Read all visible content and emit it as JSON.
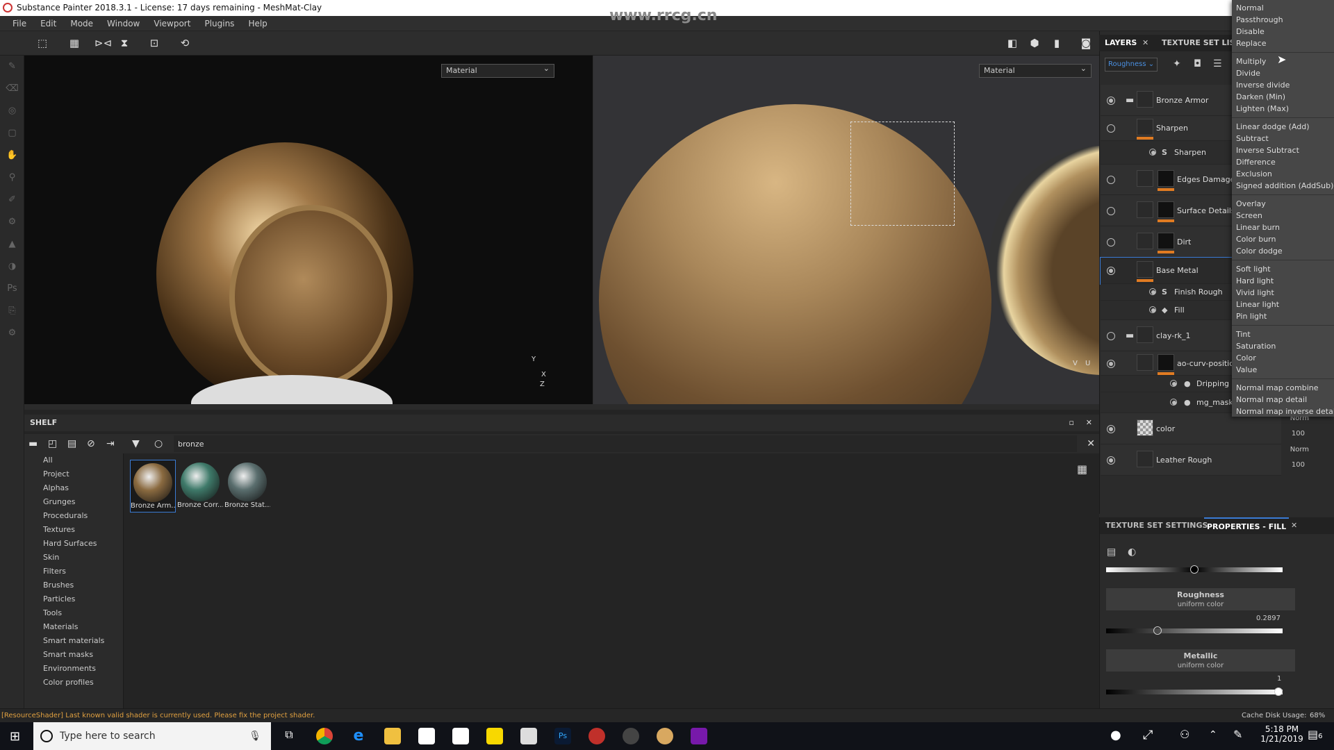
{
  "title": "Substance Painter 2018.3.1 - License: 17 days remaining - MeshMat-Clay",
  "menu": [
    "File",
    "Edit",
    "Mode",
    "Window",
    "Viewport",
    "Plugins",
    "Help"
  ],
  "viewport3d": {
    "mode": "Material",
    "axes": [
      "Y",
      "X",
      "Z"
    ]
  },
  "viewport2d": {
    "mode": "Material",
    "axes": [
      "V",
      "U"
    ]
  },
  "watermark": "www.rrcg.cn",
  "shelf": {
    "title": "SHELF",
    "search": "bronze",
    "categories": [
      "All",
      "Project",
      "Alphas",
      "Grunges",
      "Procedurals",
      "Textures",
      "Hard Surfaces",
      "Skin",
      "Filters",
      "Brushes",
      "Particles",
      "Tools",
      "Materials",
      "Smart materials",
      "Smart masks",
      "Environments",
      "Color profiles"
    ],
    "items": [
      {
        "label": "Bronze Arm...",
        "color": "#8a6a40"
      },
      {
        "label": "Bronze Corr...",
        "color": "#3f7a6a"
      },
      {
        "label": "Bronze Stat...",
        "color": "#5a6e6e"
      }
    ]
  },
  "layers": {
    "tabs": [
      "LAYERS",
      "TEXTURE SET LIST"
    ],
    "channel": "Roughness",
    "rows": [
      {
        "name": "Bronze Armor",
        "vis": true,
        "folder": true,
        "lvl": 0
      },
      {
        "name": "Sharpen",
        "vis": false,
        "lvl": 0,
        "bar": true
      },
      {
        "name": "Sharpen",
        "vis": true,
        "lvl": 1,
        "icon": "S"
      },
      {
        "name": "Edges Damages",
        "vis": false,
        "lvl": 0,
        "mask": true,
        "bar": true
      },
      {
        "name": "Surface Details",
        "vis": false,
        "lvl": 0,
        "mask": true,
        "bar": true
      },
      {
        "name": "Dirt",
        "vis": false,
        "lvl": 0,
        "mask": true,
        "bar": true
      },
      {
        "name": "Base Metal",
        "vis": true,
        "lvl": 0,
        "bar": true,
        "selected": true
      },
      {
        "name": "Finish Rough",
        "vis": true,
        "lvl": 1,
        "icon": "S"
      },
      {
        "name": "Fill",
        "vis": true,
        "lvl": 1,
        "icon": "◆"
      },
      {
        "name": "clay-rk_1",
        "vis": false,
        "folder": true,
        "lvl": 0
      },
      {
        "name": "ao-curv-position",
        "vis": true,
        "lvl": 0,
        "mask": true,
        "bar": true
      },
      {
        "name": "Dripping Rust",
        "vis": true,
        "lvl": 2,
        "icon": "●"
      },
      {
        "name": "mg_mask_e...",
        "vis": true,
        "lvl": 2,
        "icon": "●"
      },
      {
        "name": "color",
        "vis": true,
        "lvl": 0,
        "blend": "Norm",
        "opacity": "100"
      },
      {
        "name": "Leather Rough",
        "vis": true,
        "lvl": 0,
        "blend": "Norm",
        "opacity": "100"
      }
    ]
  },
  "blend_modes": [
    [
      "Normal",
      "Passthrough",
      "Disable",
      "Replace"
    ],
    [
      "Multiply",
      "Divide",
      "Inverse divide",
      "Darken (Min)",
      "Lighten (Max)"
    ],
    [
      "Linear dodge (Add)",
      "Subtract",
      "Inverse Subtract",
      "Difference",
      "Exclusion",
      "Signed addition (AddSub)"
    ],
    [
      "Overlay",
      "Screen",
      "Linear burn",
      "Color burn",
      "Color dodge"
    ],
    [
      "Soft light",
      "Hard light",
      "Vivid light",
      "Linear light",
      "Pin light"
    ],
    [
      "Tint",
      "Saturation",
      "Color",
      "Value"
    ],
    [
      "Normal map combine",
      "Normal map detail",
      "Normal map inverse detail"
    ]
  ],
  "properties": {
    "tabs": [
      "TEXTURE SET SETTINGS",
      "PROPERTIES - FILL"
    ],
    "roughness": {
      "title": "Roughness",
      "sub": "uniform color",
      "value": "0.2897"
    },
    "metallic": {
      "title": "Metallic",
      "sub": "uniform color",
      "value": "1"
    }
  },
  "status": {
    "message": "[ResourceShader] Last known valid shader is currently used. Please fix the project shader.",
    "cache_label": "Cache Disk Usage:",
    "cache_value": "68%"
  },
  "taskbar": {
    "search_placeholder": "Type here to search",
    "time": "5:18 PM",
    "date": "1/21/2019",
    "notifications": "6"
  },
  "colors": {
    "accent": "#e07b22",
    "selection": "#3a7bd5",
    "status_warning": "#e0a040"
  }
}
